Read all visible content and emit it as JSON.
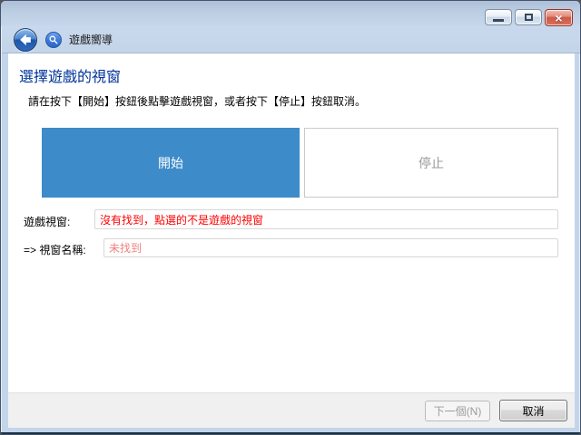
{
  "window": {
    "controls": {
      "minimize_icon": "minimize-icon",
      "maximize_icon": "maximize-icon",
      "close_icon": "close-icon",
      "close_glyph": "×"
    }
  },
  "header": {
    "back_icon": "back-arrow-icon",
    "search_icon": "magnifier-icon",
    "title": "遊戲嚮導"
  },
  "main": {
    "heading": "選擇遊戲的視窗",
    "instruction": "請在按下【開始】按鈕後點擊遊戲視窗，或者按下【停止】按鈕取消。",
    "start_button": "開始",
    "stop_button": "停止",
    "fields": [
      {
        "label": "遊戲視窗:",
        "value": "沒有找到，點選的不是遊戲的視窗"
      },
      {
        "label": "=> 視窗名稱:",
        "value": "未找到"
      }
    ]
  },
  "footer": {
    "next_label": "下一個(N)",
    "cancel_label": "取消"
  },
  "colors": {
    "accent_blue": "#3D8BC9",
    "heading_blue": "#003399",
    "error_red": "#FE0000",
    "muted_red": "#F08080",
    "chrome_blue": "#C3D5EA",
    "footer_gray": "#F0F0F0"
  }
}
